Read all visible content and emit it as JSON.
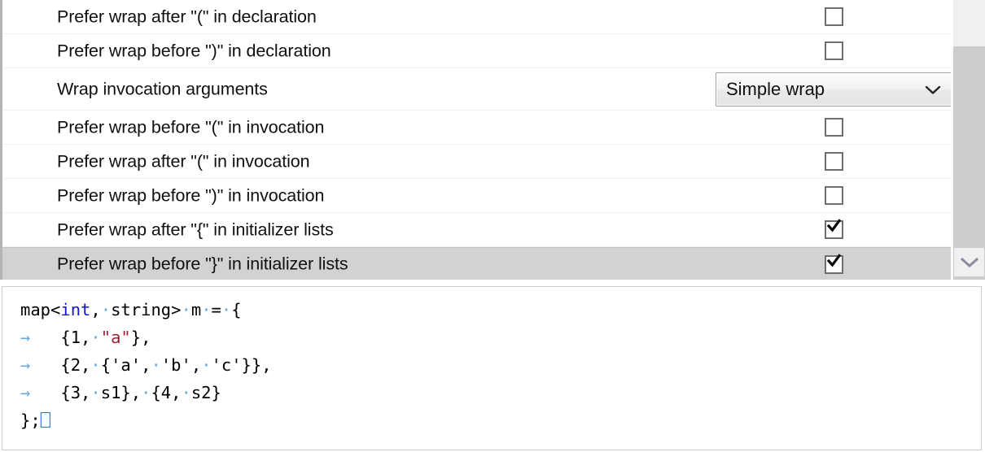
{
  "options": {
    "rows": [
      {
        "label": "Prefer wrap after \"(\" in declaration",
        "control": "checkbox",
        "checked": false
      },
      {
        "label": "Prefer wrap before \")\" in declaration",
        "control": "checkbox",
        "checked": false
      },
      {
        "label": "Wrap invocation arguments",
        "control": "combobox",
        "value": "Simple wrap"
      },
      {
        "label": "Prefer wrap before \"(\" in invocation",
        "control": "checkbox",
        "checked": false
      },
      {
        "label": "Prefer wrap after \"(\" in invocation",
        "control": "checkbox",
        "checked": false
      },
      {
        "label": "Prefer wrap before \")\" in invocation",
        "control": "checkbox",
        "checked": false
      },
      {
        "label": "Prefer wrap after \"{\" in initializer lists",
        "control": "checkbox",
        "checked": true
      },
      {
        "label": "Prefer wrap before \"}\" in initializer lists",
        "control": "checkbox",
        "checked": true,
        "selected": true
      }
    ]
  },
  "scrollbar": {
    "down_arrow_icon": "chevron-down-icon"
  },
  "preview": {
    "lines": [
      {
        "segments": [
          {
            "text": "map<",
            "type": "plain"
          },
          {
            "text": "int",
            "type": "keyword"
          },
          {
            "text": ",",
            "type": "plain"
          },
          {
            "text": "·",
            "type": "whitespace"
          },
          {
            "text": "string>",
            "type": "plain"
          },
          {
            "text": "·",
            "type": "whitespace"
          },
          {
            "text": "m",
            "type": "plain"
          },
          {
            "text": "·",
            "type": "whitespace"
          },
          {
            "text": "=",
            "type": "plain"
          },
          {
            "text": "·",
            "type": "whitespace"
          },
          {
            "text": "{",
            "type": "plain"
          }
        ]
      },
      {
        "segments": [
          {
            "text": "→",
            "type": "tab"
          },
          {
            "text": "   {1,",
            "type": "plain"
          },
          {
            "text": "·",
            "type": "whitespace"
          },
          {
            "text": "\"a\"",
            "type": "string"
          },
          {
            "text": "},",
            "type": "plain"
          }
        ]
      },
      {
        "segments": [
          {
            "text": "→",
            "type": "tab"
          },
          {
            "text": "   {2,",
            "type": "plain"
          },
          {
            "text": "·",
            "type": "whitespace"
          },
          {
            "text": "{'a',",
            "type": "plain"
          },
          {
            "text": "·",
            "type": "whitespace"
          },
          {
            "text": "'b',",
            "type": "plain"
          },
          {
            "text": "·",
            "type": "whitespace"
          },
          {
            "text": "'c'}},",
            "type": "plain"
          }
        ]
      },
      {
        "segments": [
          {
            "text": "→",
            "type": "tab"
          },
          {
            "text": "   {3,",
            "type": "plain"
          },
          {
            "text": "·",
            "type": "whitespace"
          },
          {
            "text": "s1},",
            "type": "plain"
          },
          {
            "text": "·",
            "type": "whitespace"
          },
          {
            "text": "{4,",
            "type": "plain"
          },
          {
            "text": "·",
            "type": "whitespace"
          },
          {
            "text": "s2}",
            "type": "plain"
          }
        ]
      },
      {
        "segments": [
          {
            "text": "};",
            "type": "plain"
          },
          {
            "text": "⎕",
            "type": "eol"
          }
        ]
      }
    ],
    "raw_text": "map<int, string> m = {\n\t{1, \"a\"},\n\t{2, {'a', 'b', 'c'}},\n\t{3, s1}, {4, s2}\n};"
  },
  "colors": {
    "keyword": "#1414d2",
    "string": "#9b2335",
    "whitespace_dot": "#6aa9dd",
    "selection": "#d2d2d2",
    "scroll_track": "#cdcdcd"
  }
}
